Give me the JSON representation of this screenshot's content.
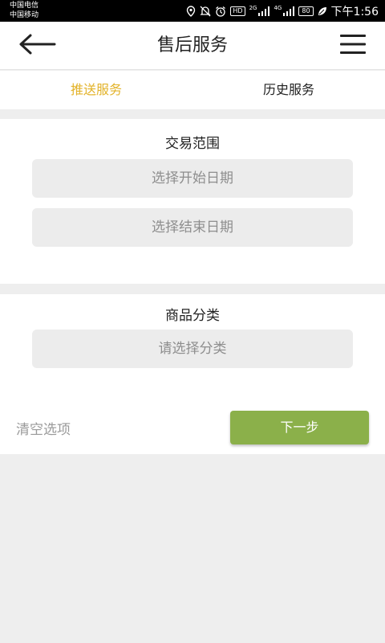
{
  "status_bar": {
    "carrier_1": "中国电信",
    "carrier_2": "中国移动",
    "hd": "HD",
    "net_1": "2G",
    "net_2": "4G",
    "battery": "80",
    "time": "下午1:56",
    "icons": [
      "location-icon",
      "mute-icon",
      "alarm-icon",
      "signal-icon",
      "leaf-icon"
    ]
  },
  "header": {
    "title": "售后服务",
    "back_icon": "arrow-left-icon",
    "menu_icon": "hamburger-menu-icon"
  },
  "tabs": [
    {
      "label": "推送服务",
      "active": true
    },
    {
      "label": "历史服务",
      "active": false
    }
  ],
  "trade_range": {
    "title": "交易范围",
    "start_placeholder": "选择开始日期",
    "end_placeholder": "选择结束日期"
  },
  "category": {
    "title": "商品分类",
    "placeholder": "请选择分类"
  },
  "actions": {
    "clear_label": "清空选项",
    "next_label": "下一步"
  },
  "colors": {
    "accent_tab": "#e3b32a",
    "primary_button": "#8bb04a",
    "field_background": "#ececec",
    "page_background": "#eeeeee"
  }
}
